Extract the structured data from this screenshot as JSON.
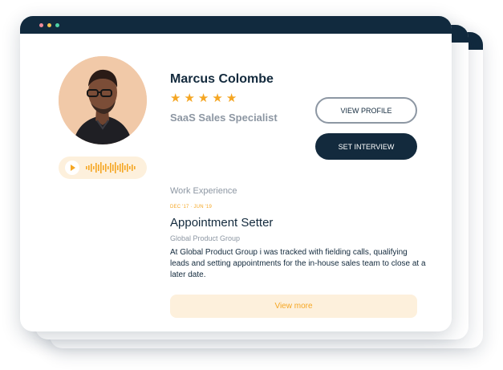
{
  "window": {
    "dots": [
      {
        "name": "close-dot",
        "color": "#f28b9a"
      },
      {
        "name": "minimize-dot",
        "color": "#f5c451"
      },
      {
        "name": "maximize-dot",
        "color": "#4fd1a5"
      }
    ]
  },
  "profile": {
    "name": "Marcus Colombe",
    "rating": 5,
    "star_glyph": "★",
    "role": "SaaS Sales Specialist",
    "audio_icon": "play-icon"
  },
  "actions": {
    "view_profile": "VIEW PROFILE",
    "set_interview": "SET INTERVIEW"
  },
  "experience": {
    "section_title": "Work Experience",
    "date_range": "DEC '17 · JUN '19",
    "job_title": "Appointment Setter",
    "company": "Global Product Group",
    "description": "At Global Product Group i was tracked with fielding calls, qualifying leads and setting appointments for the in-house sales team to close at a later date.",
    "view_more": "View more"
  },
  "colors": {
    "accent": "#f5a623",
    "navy": "#132a3d",
    "muted": "#8d97a3",
    "accent_soft": "#fdf0dc"
  }
}
